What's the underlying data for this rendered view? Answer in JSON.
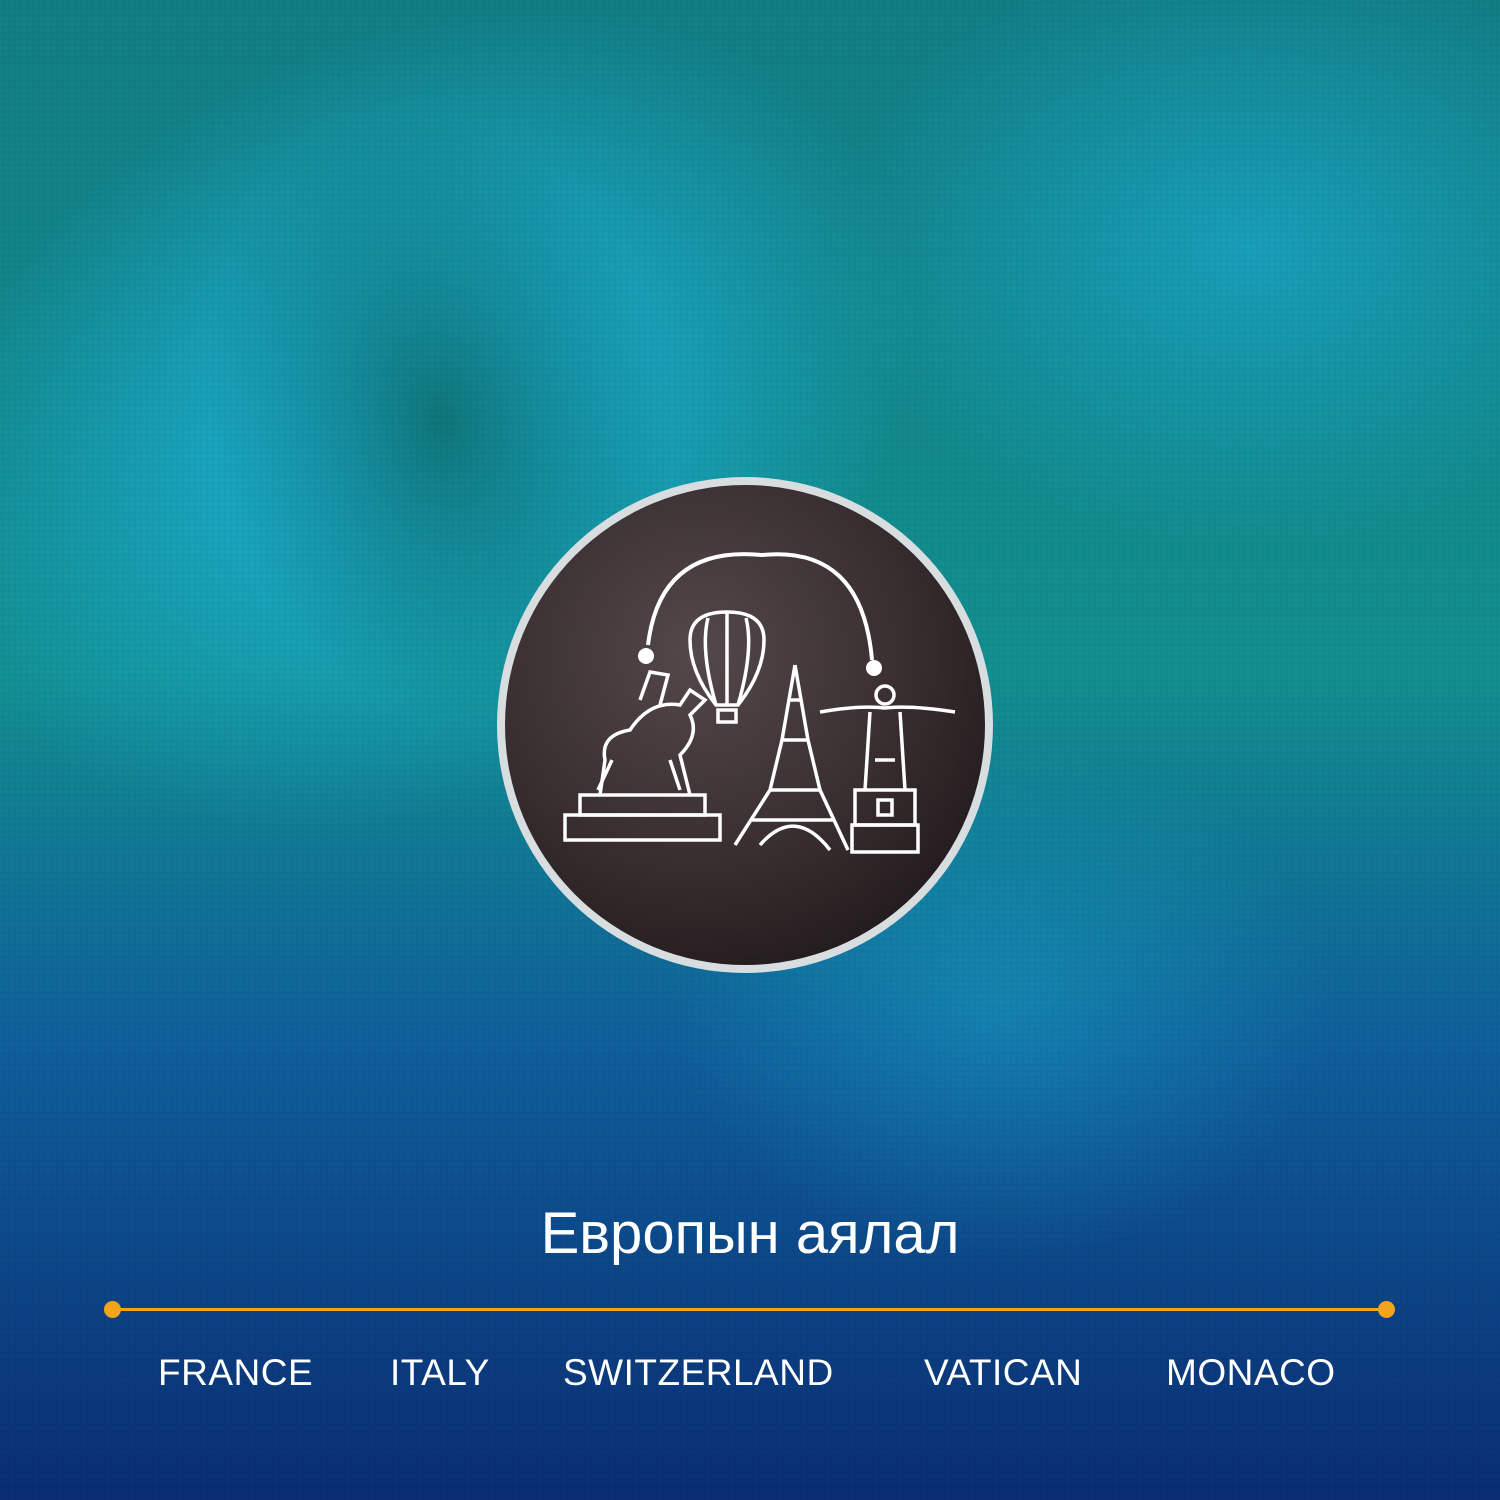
{
  "title": "Европын аялал",
  "countries": [
    "FRANCE",
    "ITALY",
    "SWITZERLAND",
    "VATICAN",
    "MONACO"
  ],
  "colors": {
    "accent": "#f3a41b",
    "text": "#ffffff",
    "fabric_light": "#19a9d3",
    "fabric_mid": "#138f8f",
    "fabric_dark": "#0c2f7a",
    "coin": "#3a2f30"
  },
  "icons": [
    "horse-statue-icon",
    "hot-air-balloon-icon",
    "eiffel-tower-icon",
    "christ-statue-icon"
  ]
}
